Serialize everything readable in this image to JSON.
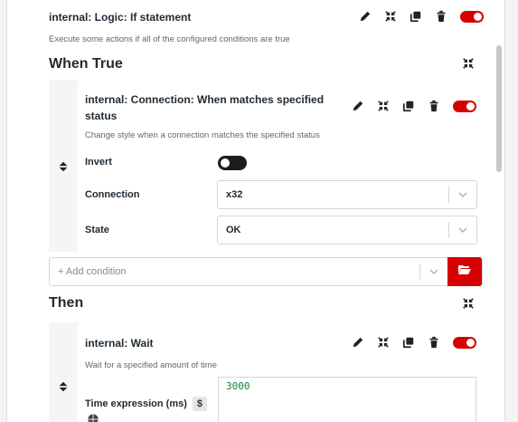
{
  "if_block": {
    "title": "internal: Logic: If statement",
    "description": "Execute some actions if all of the configured conditions are true"
  },
  "when_true": {
    "heading": "When True",
    "condition": {
      "title_line1": "internal: Connection: When matches specified",
      "title_line2": "status",
      "description": "Change style when a connection matches the specified status",
      "invert_label": "Invert",
      "connection_label": "Connection",
      "connection_value": "x32",
      "state_label": "State",
      "state_value": "OK"
    },
    "add_condition_placeholder": "+ Add condition"
  },
  "then": {
    "heading": "Then",
    "action": {
      "title": "internal: Wait",
      "description": "Wait for a specified amount of time",
      "time_label": "Time expression (ms)",
      "dollar": "$",
      "time_value": "3000"
    }
  },
  "colors": {
    "accent": "#d50000",
    "text": "#1f2a33",
    "muted": "#666666"
  },
  "icons": [
    "pencil-icon",
    "collapse-icon",
    "copy-icon",
    "trash-icon",
    "toggle-enabled",
    "drag-handle-icon",
    "chevron-down-icon",
    "folder-open-icon",
    "globe-icon"
  ]
}
